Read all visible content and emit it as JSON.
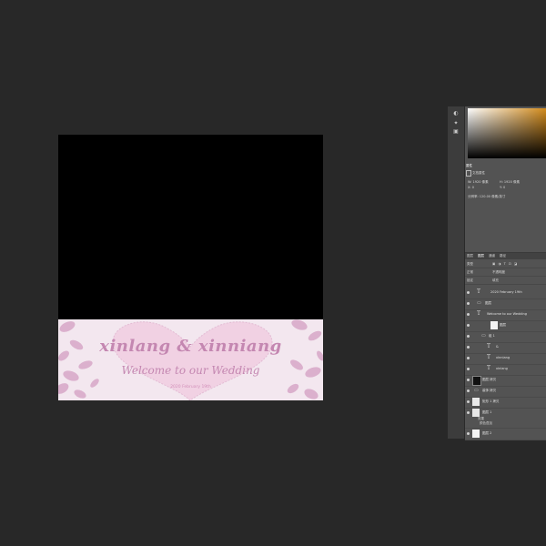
{
  "document": {
    "names": "xinlang & xinniang",
    "welcome": "Welcome to our Wedding",
    "date": "2020 February 19th"
  },
  "colors": {
    "accent": "#c487b1",
    "banner_bg": "#f3e7ef",
    "heart": "#f0cde0",
    "leaf": "#dbb0cd",
    "picker_hue": "#d28b1c"
  },
  "panels": {
    "properties_title": "属性",
    "properties_type": "文档属性",
    "width_label": "W: 1920 像素",
    "height_label": "H: 1920 像素",
    "x_label": "X: 0",
    "y_label": "Y: 0",
    "resolution": "分辨率: 120.00 像素/英寸",
    "tabs": [
      "图层",
      "通道",
      "路径",
      "历史"
    ],
    "filter_kind": "类型",
    "blend_mode": "正常",
    "opacity": "不透明度",
    "lock": "锁定",
    "fill": "填充"
  },
  "layers": [
    {
      "name": "2020 February 19th",
      "kind": "text"
    },
    {
      "name": "图层",
      "kind": "group"
    },
    {
      "name": "Welcome to our Wedding",
      "kind": "text"
    },
    {
      "name": "图层",
      "kind": "pixel"
    },
    {
      "name": "组 1",
      "kind": "group"
    },
    {
      "name": "&",
      "kind": "text"
    },
    {
      "name": "xinniang",
      "kind": "text"
    },
    {
      "name": "xinlang",
      "kind": "text"
    },
    {
      "name": "图层 拷贝",
      "kind": "pixel"
    },
    {
      "name": "装饰 拷贝",
      "kind": "group"
    },
    {
      "name": "矩形 1 拷贝",
      "kind": "pixel"
    },
    {
      "name": "图层 1",
      "kind": "pixel"
    },
    {
      "name": "效果",
      "kind": "effect"
    },
    {
      "name": "颜色叠加",
      "kind": "effect"
    },
    {
      "name": "图层 2",
      "kind": "pixel"
    },
    {
      "name": "图层 3",
      "kind": "pixel"
    }
  ]
}
